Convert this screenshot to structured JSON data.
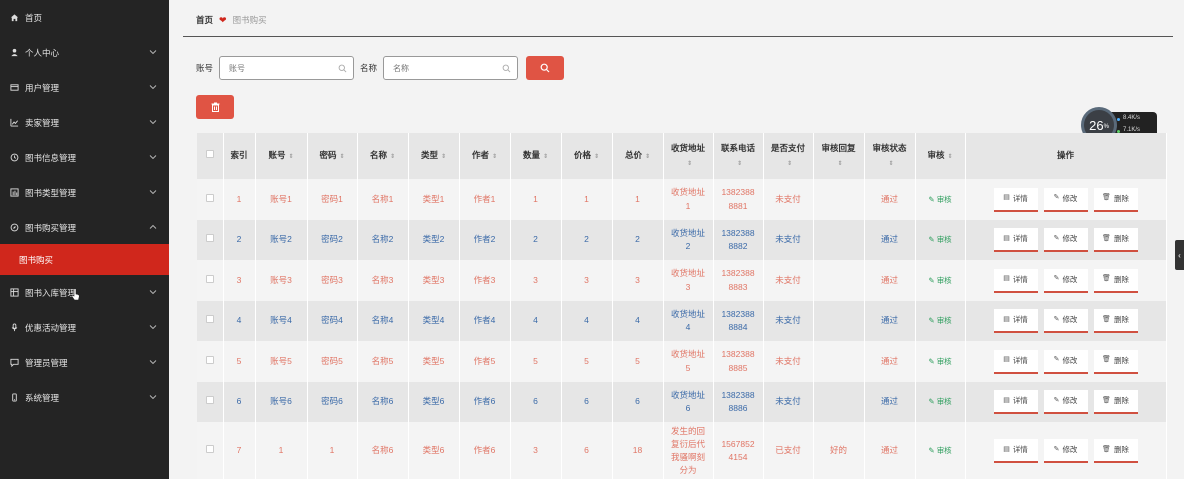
{
  "sidebar": {
    "items": [
      {
        "label": "首页",
        "icon": "home-icon"
      },
      {
        "label": "个人中心",
        "icon": "user-icon"
      },
      {
        "label": "用户管理",
        "icon": "card-icon"
      },
      {
        "label": "卖家管理",
        "icon": "chart-icon"
      },
      {
        "label": "图书信息管理",
        "icon": "clock-icon"
      },
      {
        "label": "图书类型管理",
        "icon": "bar-icon"
      },
      {
        "label": "图书购买管理",
        "icon": "compass-icon"
      },
      {
        "label": "图书购买",
        "icon": ""
      },
      {
        "label": "图书入库管理",
        "icon": "grid-icon"
      },
      {
        "label": "优惠活动管理",
        "icon": "mic-icon"
      },
      {
        "label": "管理员管理",
        "icon": "chat-icon"
      },
      {
        "label": "系统管理",
        "icon": "phone-icon"
      }
    ]
  },
  "breadcrumb": {
    "home": "首页",
    "current": "图书购买"
  },
  "search": {
    "account_label": "账号",
    "account_placeholder": "账号",
    "name_label": "名称",
    "name_placeholder": "名称"
  },
  "widget": {
    "percent": "26",
    "unit": "%",
    "up": "8.4",
    "up_unit": "K/s",
    "down": "7.1",
    "down_unit": "K/s"
  },
  "table": {
    "headers": [
      "索引",
      "账号",
      "密码",
      "名称",
      "类型",
      "作者",
      "数量",
      "价格",
      "总价",
      "收货地址",
      "联系电话",
      "是否支付",
      "审核回复",
      "审核状态",
      "审核",
      "操作"
    ],
    "op_labels": {
      "detail": "详情",
      "edit": "修改",
      "delete": "删除",
      "audit": "审核"
    },
    "rows": [
      {
        "idx": "1",
        "account": "账号1",
        "password": "密码1",
        "name": "名称1",
        "type": "类型1",
        "author": "作者1",
        "qty": "1",
        "price": "1",
        "total": "1",
        "address": "收货地址1",
        "phone": "13823888881",
        "paid": "未支付",
        "reply": "",
        "status": "通过"
      },
      {
        "idx": "2",
        "account": "账号2",
        "password": "密码2",
        "name": "名称2",
        "type": "类型2",
        "author": "作者2",
        "qty": "2",
        "price": "2",
        "total": "2",
        "address": "收货地址2",
        "phone": "13823888882",
        "paid": "未支付",
        "reply": "",
        "status": "通过"
      },
      {
        "idx": "3",
        "account": "账号3",
        "password": "密码3",
        "name": "名称3",
        "type": "类型3",
        "author": "作者3",
        "qty": "3",
        "price": "3",
        "total": "3",
        "address": "收货地址3",
        "phone": "13823888883",
        "paid": "未支付",
        "reply": "",
        "status": "通过"
      },
      {
        "idx": "4",
        "account": "账号4",
        "password": "密码4",
        "name": "名称4",
        "type": "类型4",
        "author": "作者4",
        "qty": "4",
        "price": "4",
        "total": "4",
        "address": "收货地址4",
        "phone": "13823888884",
        "paid": "未支付",
        "reply": "",
        "status": "通过"
      },
      {
        "idx": "5",
        "account": "账号5",
        "password": "密码5",
        "name": "名称5",
        "type": "类型5",
        "author": "作者5",
        "qty": "5",
        "price": "5",
        "total": "5",
        "address": "收货地址5",
        "phone": "13823888885",
        "paid": "未支付",
        "reply": "",
        "status": "通过"
      },
      {
        "idx": "6",
        "account": "账号6",
        "password": "密码6",
        "name": "名称6",
        "type": "类型6",
        "author": "作者6",
        "qty": "6",
        "price": "6",
        "total": "6",
        "address": "收货地址6",
        "phone": "13823888886",
        "paid": "未支付",
        "reply": "",
        "status": "通过"
      },
      {
        "idx": "7",
        "account": "1",
        "password": "1",
        "name": "名称6",
        "type": "类型6",
        "author": "作者6",
        "qty": "3",
        "price": "6",
        "total": "18",
        "address": "发生的回复衍后代我骚啊刻分为",
        "phone": "15678524154",
        "paid": "已支付",
        "reply": "好的",
        "status": "通过"
      }
    ]
  },
  "colors": {
    "accent": "#d0271c",
    "sidebar_bg": "#242424",
    "odd_text": "#e07565",
    "even_text": "#3b6aa8",
    "audit_green": "#2f9e5e"
  }
}
